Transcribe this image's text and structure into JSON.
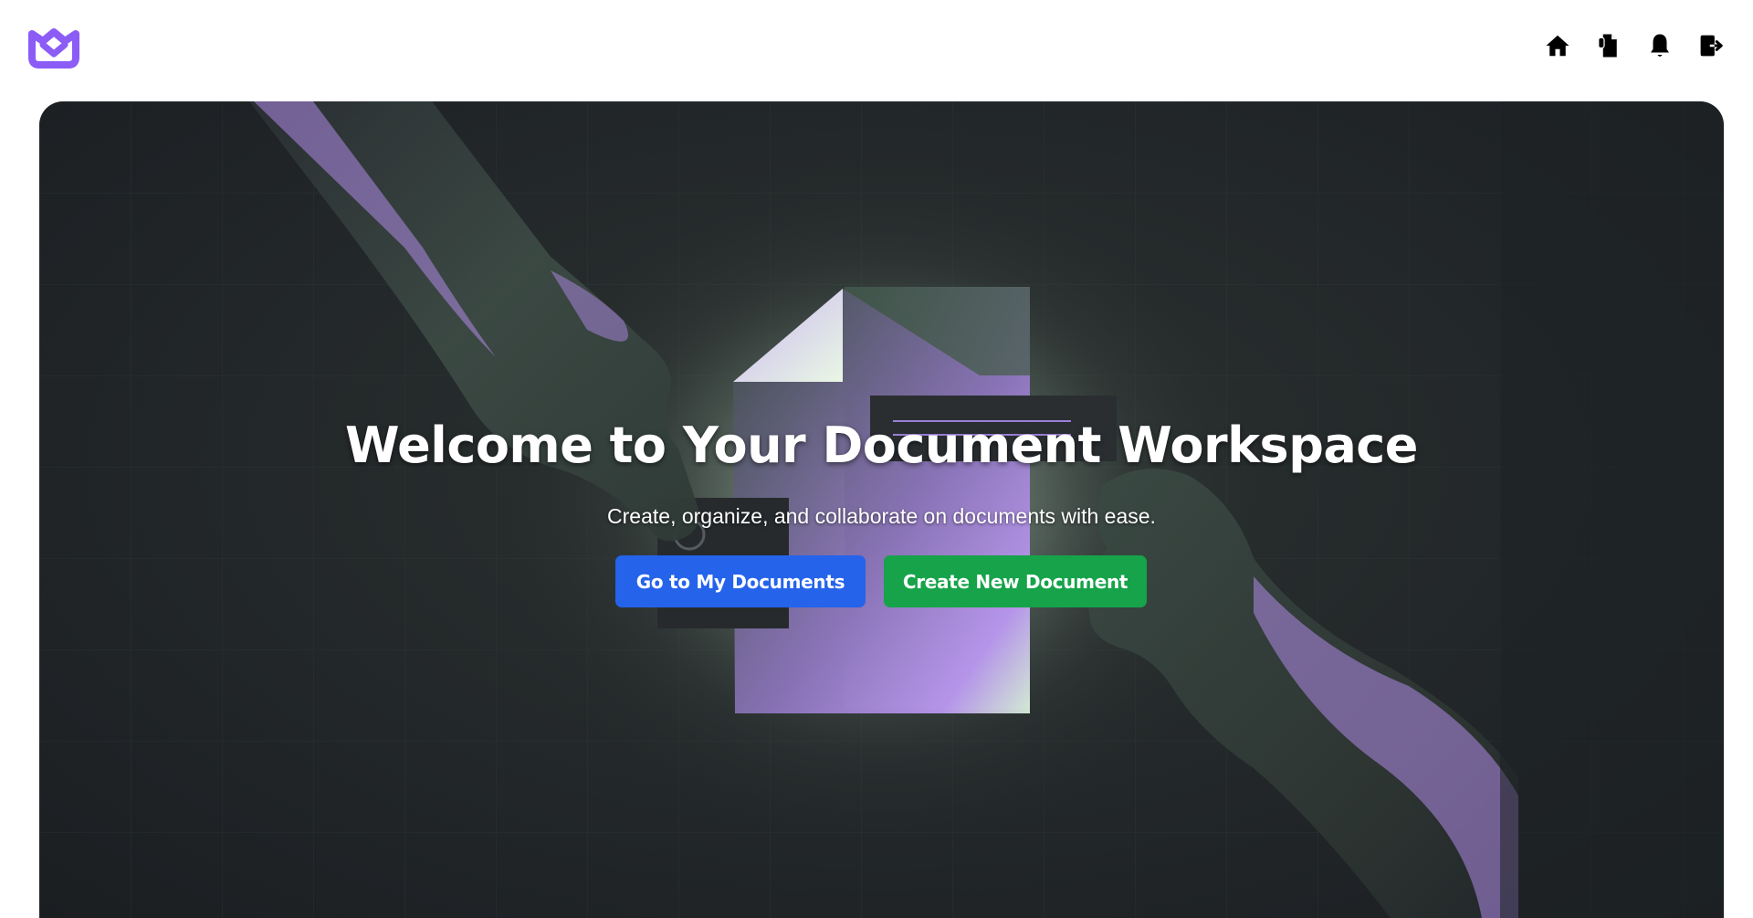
{
  "header": {
    "logo_name": "book-logo-icon",
    "brand_color": "#8b5cf6",
    "nav": [
      {
        "name": "home-icon",
        "label": "Home"
      },
      {
        "name": "documents-icon",
        "label": "Documents"
      },
      {
        "name": "bell-icon",
        "label": "Notifications"
      },
      {
        "name": "logout-icon",
        "label": "Logout"
      }
    ]
  },
  "hero": {
    "title": "Welcome to Your Document Workspace",
    "subtitle": "Create, organize, and collaborate on documents with ease.",
    "primary_button": "Go to My Documents",
    "secondary_button": "Create New Document",
    "primary_color": "#2563eb",
    "secondary_color": "#16a34a"
  }
}
